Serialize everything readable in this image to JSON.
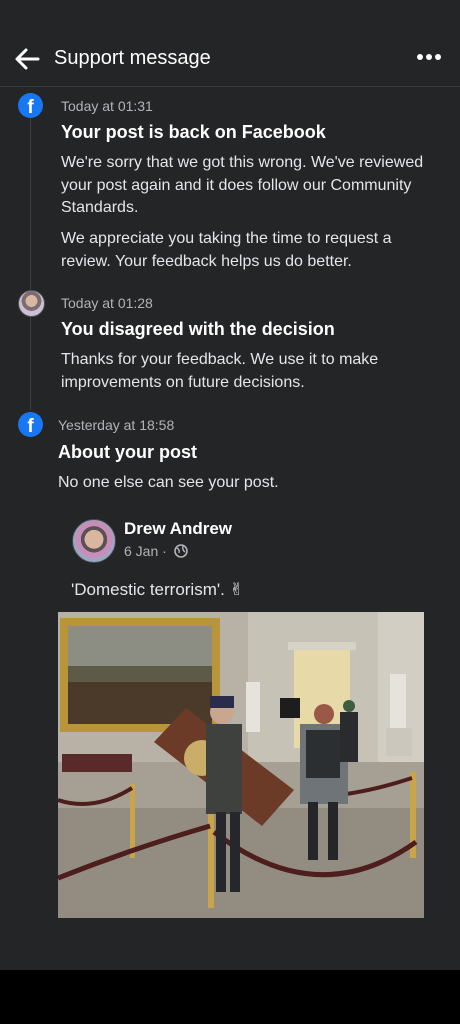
{
  "header": {
    "title": "Support message",
    "back_icon": "arrow-left-icon",
    "more_icon": "more-horizontal-icon"
  },
  "messages": [
    {
      "icon": "facebook-icon",
      "timestamp": "Today at 01:31",
      "heading": "Your post is back on Facebook",
      "paragraphs": [
        "We're sorry that we got this wrong. We've reviewed your post again and it does follow our Community Standards.",
        "We appreciate you taking the time to request a review. Your feedback helps us do better."
      ]
    },
    {
      "icon": "user-avatar",
      "timestamp": "Today at 01:28",
      "heading": "You disagreed with the decision",
      "paragraphs": [
        "Thanks for your feedback. We use it to make improvements on future decisions."
      ]
    },
    {
      "icon": "facebook-icon",
      "timestamp": "Yesterday at 18:58",
      "heading": "About your post",
      "paragraphs": [
        "No one else can see your post."
      ]
    }
  ],
  "post": {
    "author": "Drew Andrew",
    "date": "6 Jan ·",
    "privacy_icon": "globe-icon",
    "text": "'Domestic terrorism'. ✌"
  },
  "colors": {
    "background": "#242526",
    "facebook_blue": "#1877f2",
    "secondary_text": "#b0b3b8"
  }
}
